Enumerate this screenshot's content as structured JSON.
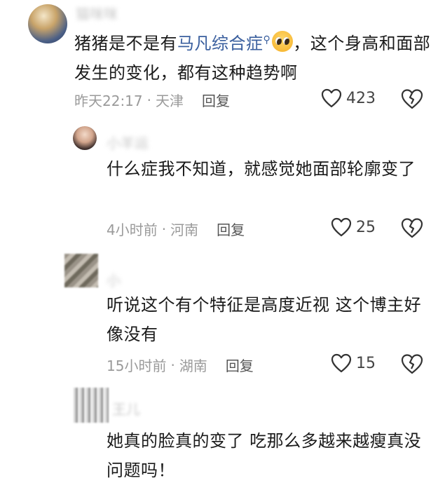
{
  "comments": [
    {
      "username": "猫咪咪",
      "text_before": "猪猪是不是有",
      "link_text": "马凡综合症",
      "text_after": "，这个身高和面部发生的变化，都有这种趋势啊",
      "time": "昨天22:17",
      "location": "天津",
      "reply_label": "回复",
      "likes": "423",
      "avatar_icon": "user-avatar-icon"
    },
    {
      "username": "小羊运",
      "text": "什么症我不知道，就感觉她面部轮廓变了",
      "time": "4小时前",
      "location": "河南",
      "reply_label": "回复",
      "likes": "25",
      "avatar_icon": "user-avatar-icon"
    },
    {
      "username": "小",
      "text": "听说这个有个特征是高度近视 这个博主好像没有",
      "time": "15小时前",
      "location": "湖南",
      "reply_label": "回复",
      "likes": "15",
      "avatar_icon": "user-avatar-icon"
    },
    {
      "username": "王儿",
      "text": "她真的脸真的变了  吃那么多越来越瘦真没问题吗！",
      "avatar_icon": "user-avatar-icon"
    }
  ],
  "separator": "·",
  "icons": {
    "search": "search-icon",
    "emoji": "pleading-face-emoji-icon",
    "like": "heart-icon",
    "dislike": "broken-heart-icon"
  },
  "colors": {
    "link": "#3a5f9e",
    "meta": "#9a9a9a",
    "text": "#1a1a1a"
  }
}
